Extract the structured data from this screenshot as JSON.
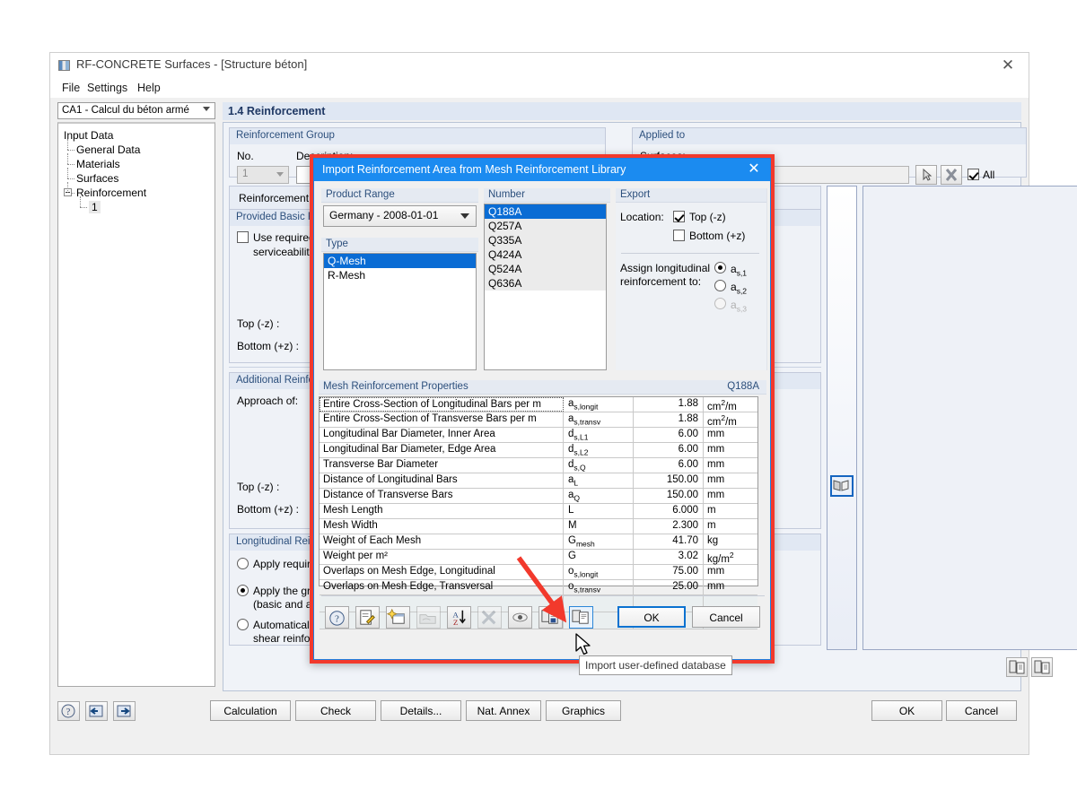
{
  "window": {
    "title": "RF-CONCRETE Surfaces - [Structure béton]",
    "close_label": "✕",
    "menu": [
      "File",
      "Settings",
      "Help"
    ]
  },
  "sidebar": {
    "combo_value": "CA1 - Calcul du béton armé",
    "tree": [
      {
        "label": "Input Data",
        "level": 0
      },
      {
        "label": "General Data",
        "level": 1
      },
      {
        "label": "Materials",
        "level": 1
      },
      {
        "label": "Surfaces",
        "level": 1
      },
      {
        "label": "Reinforcement",
        "level": 1
      },
      {
        "label": "1",
        "level": 2
      }
    ]
  },
  "page": {
    "header": "1.4 Reinforcement",
    "reinforcement_group": {
      "title": "Reinforcement Group",
      "no_label": "No.",
      "no_value": "1",
      "description_label": "Description:"
    },
    "applied_to": {
      "title": "Applied to",
      "surfaces_label": "Surfaces:",
      "all_label": "All"
    },
    "tab_label": "Reinforcement Ratio",
    "provided_basic": {
      "title": "Provided Basic Rein",
      "checkbox_label_line1": "Use required rein",
      "checkbox_label_line2": "serviceability",
      "top_label": "Top (-z) :",
      "bottom_label": "Bottom (+z) :"
    },
    "additional": {
      "title": "Additional Reinforce",
      "approach_label": "Approach of:",
      "top_label": "Top (-z) :",
      "bottom_label": "Bottom (+z) :"
    },
    "longitudinal": {
      "title": "Longitudinal Reinfor",
      "option1": "Apply required lo",
      "option2_line1": "Apply the greate",
      "option2_line2": "(basic and add. r",
      "option3_line1": "Automatically inc",
      "option3_line2": "shear reinforcem"
    }
  },
  "bottom_bar": {
    "buttons": [
      "Calculation",
      "Check",
      "Details...",
      "Nat. Annex",
      "Graphics"
    ],
    "ok": "OK",
    "cancel": "Cancel"
  },
  "dialog": {
    "title": "Import Reinforcement Area from Mesh Reinforcement Library",
    "close_label": "✕",
    "product_range": {
      "title": "Product Range",
      "value": "Germany - 2008-01-01"
    },
    "type": {
      "title": "Type",
      "items": [
        "Q-Mesh",
        "R-Mesh"
      ],
      "selected": "Q-Mesh"
    },
    "number": {
      "title": "Number",
      "items": [
        "Q188A",
        "Q257A",
        "Q335A",
        "Q424A",
        "Q524A",
        "Q636A"
      ],
      "selected": "Q188A"
    },
    "export": {
      "title": "Export",
      "location_label": "Location:",
      "top_label": "Top (-z)",
      "top_checked": true,
      "bottom_label": "Bottom (+z)",
      "bottom_checked": false,
      "assign_label_line1": "Assign longitudinal",
      "assign_label_line2": "reinforcement to:",
      "radios": [
        {
          "label_main": "a",
          "label_sub": "s,1",
          "checked": true,
          "disabled": false
        },
        {
          "label_main": "a",
          "label_sub": "s,2",
          "checked": false,
          "disabled": false
        },
        {
          "label_main": "a",
          "label_sub": "s,3",
          "checked": false,
          "disabled": true
        }
      ]
    },
    "properties": {
      "title": "Mesh Reinforcement Properties",
      "badge": "Q188A",
      "rows": [
        {
          "desc": "Entire Cross-Section of Longitudinal Bars per m",
          "sym_main": "a",
          "sym_sub": "s,longit",
          "value": "1.88",
          "unit_main": "cm",
          "unit_sup": "2",
          "unit_tail": "/m",
          "focus": true
        },
        {
          "desc": "Entire Cross-Section of Transverse Bars per m",
          "sym_main": "a",
          "sym_sub": "s,transv",
          "value": "1.88",
          "unit_main": "cm",
          "unit_sup": "2",
          "unit_tail": "/m",
          "focus": false
        },
        {
          "desc": "Longitudinal Bar Diameter, Inner Area",
          "sym_main": "d",
          "sym_sub": "s,L1",
          "value": "6.00",
          "unit_main": "mm",
          "unit_sup": "",
          "unit_tail": "",
          "focus": false
        },
        {
          "desc": "Longitudinal Bar Diameter, Edge Area",
          "sym_main": "d",
          "sym_sub": "s,L2",
          "value": "6.00",
          "unit_main": "mm",
          "unit_sup": "",
          "unit_tail": "",
          "focus": false
        },
        {
          "desc": "Transverse Bar Diameter",
          "sym_main": "d",
          "sym_sub": "s,Q",
          "value": "6.00",
          "unit_main": "mm",
          "unit_sup": "",
          "unit_tail": "",
          "focus": false
        },
        {
          "desc": "Distance of Longitudinal Bars",
          "sym_main": "a",
          "sym_sub": "L",
          "value": "150.00",
          "unit_main": "mm",
          "unit_sup": "",
          "unit_tail": "",
          "focus": false
        },
        {
          "desc": "Distance of Transverse Bars",
          "sym_main": "a",
          "sym_sub": "Q",
          "value": "150.00",
          "unit_main": "mm",
          "unit_sup": "",
          "unit_tail": "",
          "focus": false
        },
        {
          "desc": "Mesh Length",
          "sym_main": "L",
          "sym_sub": "",
          "value": "6.000",
          "unit_main": "m",
          "unit_sup": "",
          "unit_tail": "",
          "focus": false
        },
        {
          "desc": "Mesh Width",
          "sym_main": "M",
          "sym_sub": "",
          "value": "2.300",
          "unit_main": "m",
          "unit_sup": "",
          "unit_tail": "",
          "focus": false
        },
        {
          "desc": "Weight of Each Mesh",
          "sym_main": "G",
          "sym_sub": "mesh",
          "value": "41.70",
          "unit_main": "kg",
          "unit_sup": "",
          "unit_tail": "",
          "focus": false
        },
        {
          "desc": "Weight per m²",
          "sym_main": "G",
          "sym_sub": "",
          "value": "3.02",
          "unit_main": "kg/m",
          "unit_sup": "2",
          "unit_tail": "",
          "focus": false
        },
        {
          "desc": "Overlaps on Mesh Edge, Longitudinal",
          "sym_main": "o",
          "sym_sub": "s,longit",
          "value": "75.00",
          "unit_main": "mm",
          "unit_sup": "",
          "unit_tail": "",
          "focus": false
        },
        {
          "desc": "Overlaps on Mesh Edge, Transversal",
          "sym_main": "o",
          "sym_sub": "s,transv",
          "value": "25.00",
          "unit_main": "mm",
          "unit_sup": "",
          "unit_tail": "",
          "focus": false
        }
      ]
    },
    "toolbar": [
      {
        "name": "help-icon",
        "enabled": true
      },
      {
        "name": "edit-icon",
        "enabled": true
      },
      {
        "name": "new-icon",
        "enabled": true
      },
      {
        "name": "folder-icon",
        "enabled": false
      },
      {
        "name": "sort-az-icon",
        "enabled": true
      },
      {
        "name": "delete-icon",
        "enabled": false
      },
      {
        "name": "view-icon",
        "enabled": true
      },
      {
        "name": "export-database-icon",
        "enabled": true
      },
      {
        "name": "import-database-icon",
        "enabled": true
      }
    ],
    "ok": "OK",
    "cancel": "Cancel",
    "tooltip": "Import user-defined database"
  },
  "colors": {
    "accent": "#1b8bf0",
    "highlight_border": "#f2392c",
    "selection": "#0a6cd4",
    "group_title_text": "#2c4f7c"
  }
}
